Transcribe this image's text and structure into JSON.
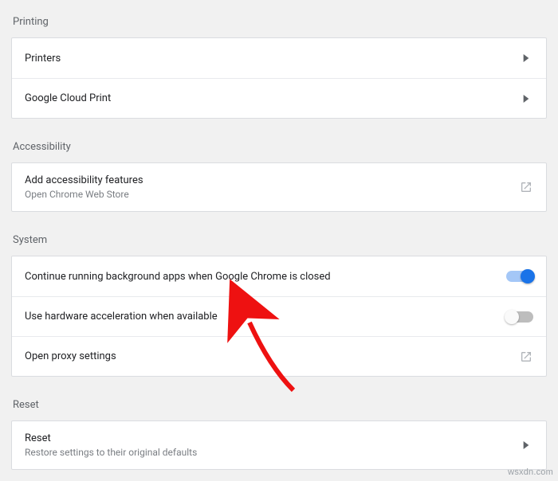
{
  "printing": {
    "header": "Printing",
    "printers": "Printers",
    "cloud_print": "Google Cloud Print"
  },
  "accessibility": {
    "header": "Accessibility",
    "title": "Add accessibility features",
    "subtitle": "Open Chrome Web Store"
  },
  "system": {
    "header": "System",
    "background_apps": "Continue running background apps when Google Chrome is closed",
    "hardware_accel": "Use hardware acceleration when available",
    "proxy": "Open proxy settings"
  },
  "reset": {
    "header": "Reset",
    "title": "Reset",
    "subtitle": "Restore settings to their original defaults"
  },
  "watermark": "wsxdn.com"
}
